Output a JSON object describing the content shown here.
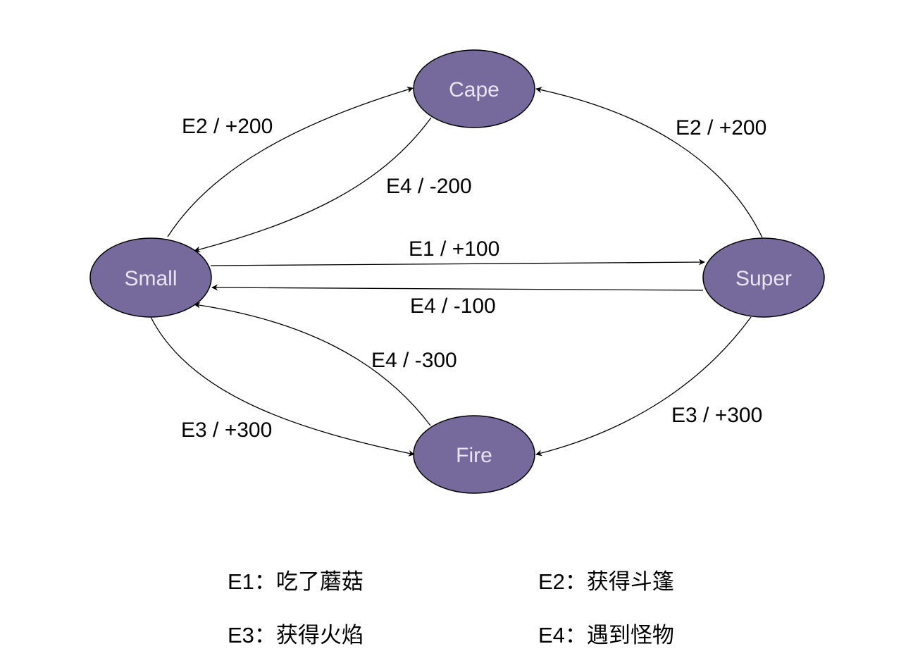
{
  "colors": {
    "node_fill": "#76699c",
    "node_text": "#e8e4f4",
    "edge": "#000000"
  },
  "nodes": {
    "cape": "Cape",
    "small": "Small",
    "super": "Super",
    "fire": "Fire"
  },
  "edges": [
    {
      "from": "Small",
      "to": "Cape",
      "label": "E2 / +200"
    },
    {
      "from": "Cape",
      "to": "Small",
      "label": "E4 / -200"
    },
    {
      "from": "Super",
      "to": "Cape",
      "label": "E2 / +200"
    },
    {
      "from": "Small",
      "to": "Super",
      "label": "E1 / +100"
    },
    {
      "from": "Super",
      "to": "Small",
      "label": "E4 / -100"
    },
    {
      "from": "Fire",
      "to": "Small",
      "label": "E4 / -300"
    },
    {
      "from": "Small",
      "to": "Fire",
      "label": "E3 / +300"
    },
    {
      "from": "Super",
      "to": "Fire",
      "label": "E3 / +300"
    }
  ],
  "legend": [
    {
      "code": "E1",
      "separator": "：",
      "text": "吃了蘑菇"
    },
    {
      "code": "E2",
      "separator": "：",
      "text": "获得斗篷"
    },
    {
      "code": "E3",
      "separator": "：",
      "text": "获得火焰"
    },
    {
      "code": "E4",
      "separator": "：",
      "text": "遇到怪物"
    }
  ]
}
